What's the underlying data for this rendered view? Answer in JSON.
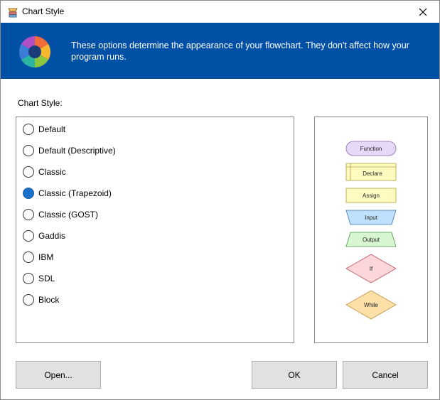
{
  "window": {
    "title": "Chart Style"
  },
  "banner": {
    "text": "These options determine the appearance of your flowchart. They don't affect how your program runs."
  },
  "section_label": "Chart Style:",
  "styles": [
    {
      "label": "Default",
      "checked": false
    },
    {
      "label": "Default (Descriptive)",
      "checked": false
    },
    {
      "label": "Classic",
      "checked": false
    },
    {
      "label": "Classic (Trapezoid)",
      "checked": true
    },
    {
      "label": "Classic (GOST)",
      "checked": false
    },
    {
      "label": "Gaddis",
      "checked": false
    },
    {
      "label": "IBM",
      "checked": false
    },
    {
      "label": "SDL",
      "checked": false
    },
    {
      "label": "Block",
      "checked": false
    }
  ],
  "preview": {
    "function": "Function",
    "declare": "Declare",
    "assign": "Assign",
    "input": "Input",
    "output": "Output",
    "if": "If",
    "while": "While",
    "colors": {
      "function": "#e6d9f7",
      "declare": "#fffbc0",
      "assign": "#fffbc0",
      "input": "#bfe0fb",
      "output": "#d6f5d0",
      "if": "#fcd6d8",
      "while": "#fde0a8"
    }
  },
  "buttons": {
    "open": "Open...",
    "ok": "OK",
    "cancel": "Cancel"
  }
}
